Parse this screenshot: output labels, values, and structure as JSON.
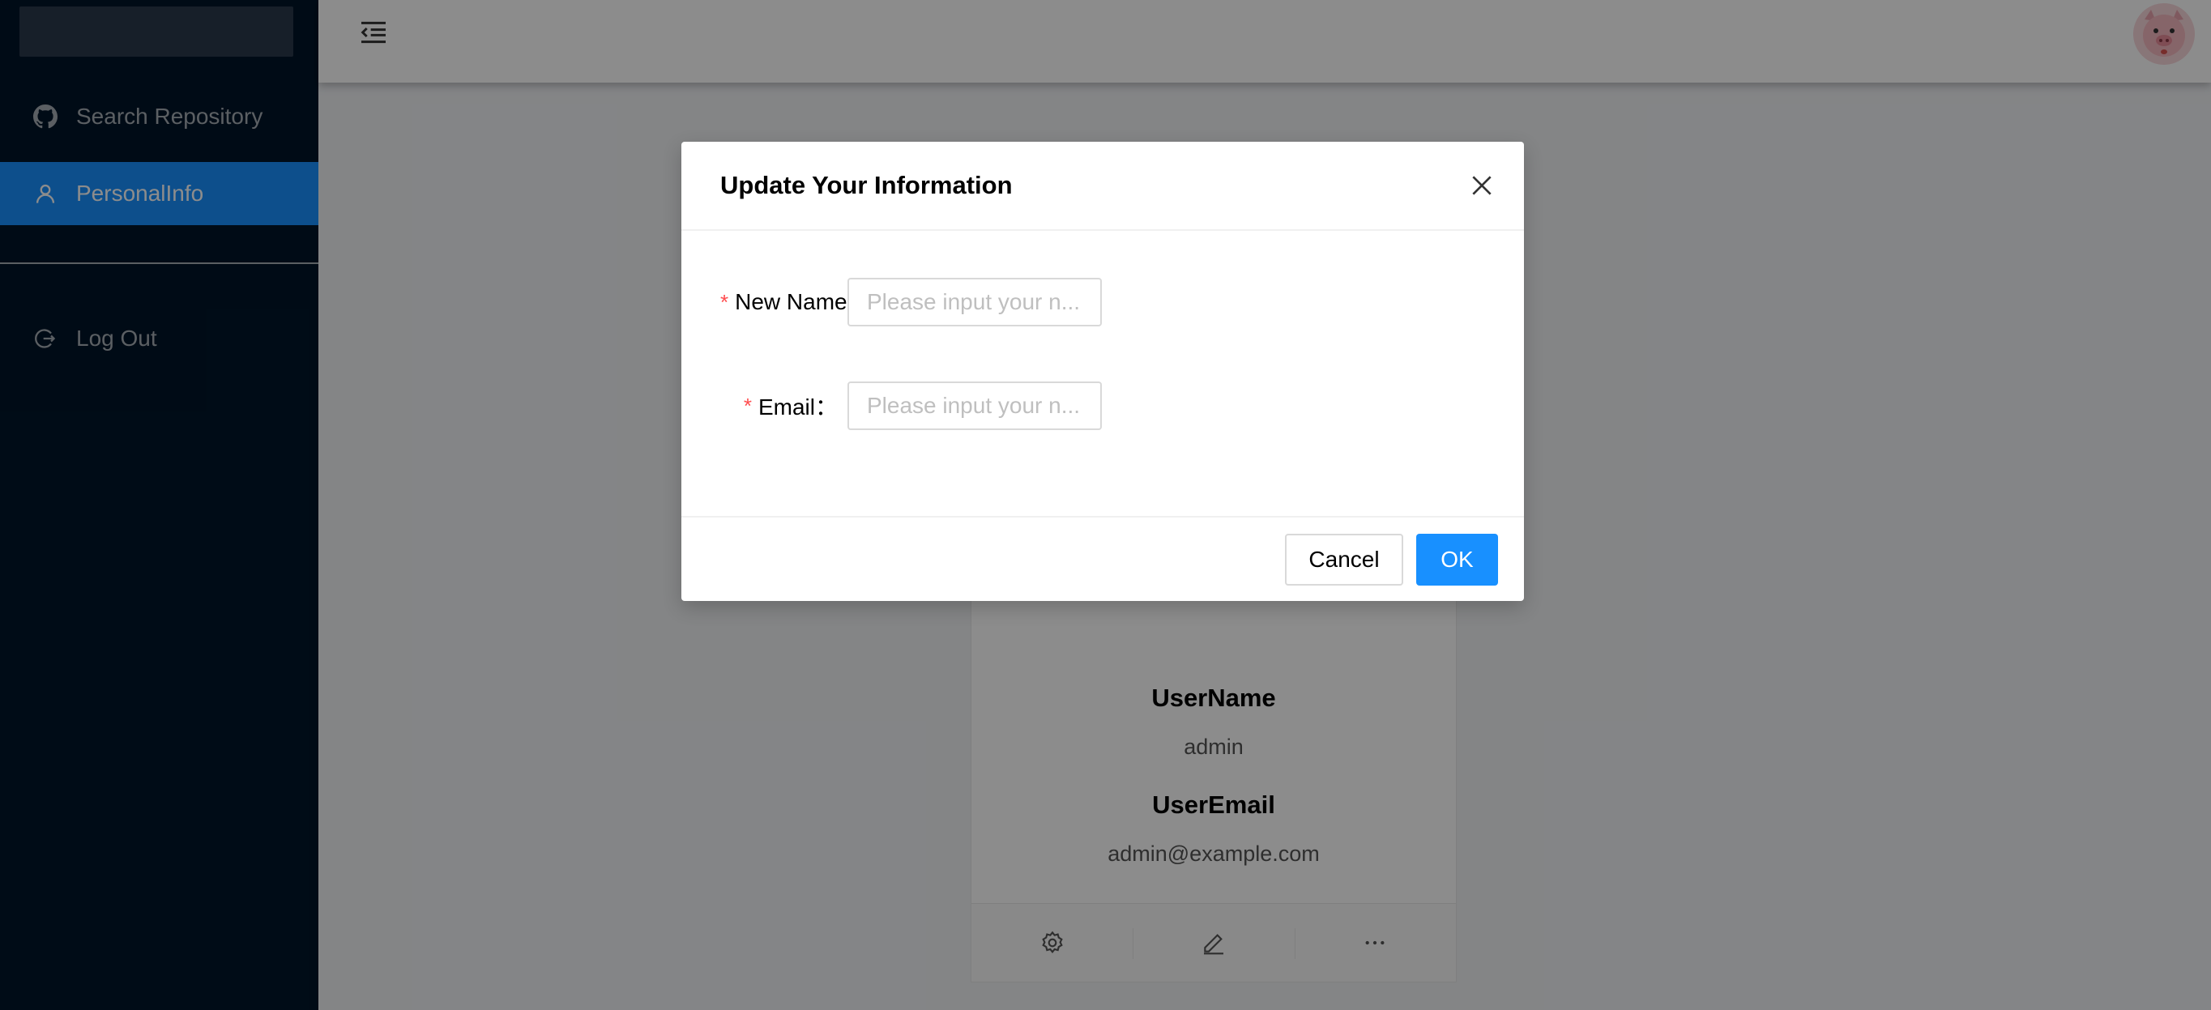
{
  "sidebar": {
    "items": [
      {
        "label": "Search Repository",
        "icon": "github-icon"
      },
      {
        "label": "PersonalInfo",
        "icon": "user-icon",
        "selected": true
      },
      {
        "label": "Log Out",
        "icon": "logout-icon"
      }
    ]
  },
  "header": {
    "menu_toggle_icon": "menu-fold-icon",
    "avatar_icon": "pig-avatar-icon"
  },
  "card": {
    "username_title": "UserName",
    "username_value": "admin",
    "email_title": "UserEmail",
    "email_value": "admin@example.com",
    "actions": [
      "setting-icon",
      "edit-icon",
      "ellipsis-icon"
    ]
  },
  "modal": {
    "title": "Update Your Information",
    "fields": [
      {
        "label": "New Name",
        "required": true,
        "placeholder": "Please input your n...",
        "value": ""
      },
      {
        "label": "Email：",
        "required": true,
        "placeholder": "Please input your n...",
        "value": ""
      }
    ],
    "cancel_label": "Cancel",
    "ok_label": "OK"
  },
  "colors": {
    "sidebar_bg": "#001529",
    "primary": "#1890ff",
    "required": "#ff4d4f"
  }
}
